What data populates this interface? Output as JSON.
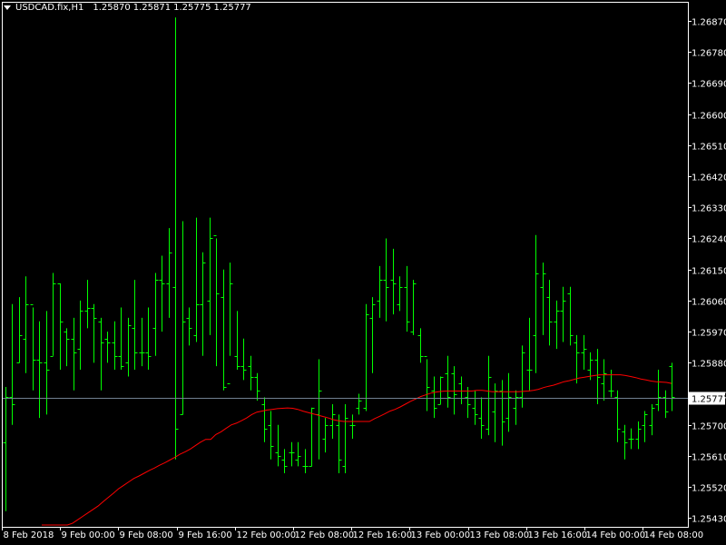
{
  "header": {
    "symbol": "USDCAD.fix,H1",
    "open": "1.25870",
    "high": "1.25871",
    "low": "1.25775",
    "close": "1.25777"
  },
  "current_price_label": "1.25777",
  "colors": {
    "background": "#000000",
    "bars": "#00ff00",
    "moving_average": "#ff0000",
    "bid_line": "#708090",
    "axis": "#ffffff",
    "text": "#ffffff"
  },
  "chart_data": {
    "type": "line",
    "chart_style": "ohlc-bars",
    "y_ticks": [
      "1.26870",
      "1.26780",
      "1.26690",
      "1.26600",
      "1.26510",
      "1.26420",
      "1.26330",
      "1.26240",
      "1.26150",
      "1.26060",
      "1.25970",
      "1.25880",
      "1.25790",
      "1.25700",
      "1.25610",
      "1.25520",
      "1.25430"
    ],
    "x_ticks": [
      "8 Feb 2018",
      "9 Feb 00:00",
      "9 Feb 08:00",
      "9 Feb 16:00",
      "12 Feb 00:00",
      "12 Feb 08:00",
      "12 Feb 16:00",
      "13 Feb 00:00",
      "13 Feb 08:00",
      "13 Feb 16:00",
      "14 Feb 00:00",
      "14 Feb 08:00"
    ],
    "ylim": [
      1.2541,
      1.2692
    ],
    "current_price": 1.25777,
    "series": [
      {
        "type": "ohlc",
        "bars": [
          {
            "h": 1.2581,
            "l": 1.2545,
            "o": 1.2565,
            "c": 1.2578
          },
          {
            "h": 1.2605,
            "l": 1.257,
            "o": 1.2578,
            "c": 1.2576
          },
          {
            "h": 1.2607,
            "l": 1.2588,
            "o": 1.2588,
            "c": 1.2596
          },
          {
            "h": 1.2613,
            "l": 1.2585,
            "o": 1.2595,
            "c": 1.2605
          },
          {
            "h": 1.2604,
            "l": 1.258,
            "o": 1.2605,
            "c": 1.2589
          },
          {
            "h": 1.26,
            "l": 1.2572,
            "o": 1.2589,
            "c": 1.2588
          },
          {
            "h": 1.2603,
            "l": 1.2573,
            "o": 1.2588,
            "c": 1.2586
          },
          {
            "h": 1.2614,
            "l": 1.259,
            "o": 1.259,
            "c": 1.2611
          },
          {
            "h": 1.2611,
            "l": 1.2586,
            "o": 1.2611,
            "c": 1.26
          },
          {
            "h": 1.2598,
            "l": 1.2587,
            "o": 1.2597,
            "c": 1.2595
          },
          {
            "h": 1.2601,
            "l": 1.258,
            "o": 1.2595,
            "c": 1.2591
          },
          {
            "h": 1.2606,
            "l": 1.2586,
            "o": 1.2592,
            "c": 1.2603
          },
          {
            "h": 1.2612,
            "l": 1.2598,
            "o": 1.2603,
            "c": 1.2604
          },
          {
            "h": 1.2605,
            "l": 1.2588,
            "o": 1.2604,
            "c": 1.2601
          },
          {
            "h": 1.2601,
            "l": 1.258,
            "o": 1.26,
            "c": 1.2594
          },
          {
            "h": 1.2597,
            "l": 1.2588,
            "o": 1.2595,
            "c": 1.2594
          },
          {
            "h": 1.26,
            "l": 1.2586,
            "o": 1.2594,
            "c": 1.259
          },
          {
            "h": 1.2604,
            "l": 1.2586,
            "o": 1.259,
            "c": 1.2587
          },
          {
            "h": 1.2601,
            "l": 1.2584,
            "o": 1.2588,
            "c": 1.2599
          },
          {
            "h": 1.2612,
            "l": 1.2586,
            "o": 1.2598,
            "c": 1.2591
          },
          {
            "h": 1.2601,
            "l": 1.2587,
            "o": 1.2591,
            "c": 1.2591
          },
          {
            "h": 1.2604,
            "l": 1.2586,
            "o": 1.2591,
            "c": 1.259
          },
          {
            "h": 1.2614,
            "l": 1.259,
            "o": 1.2598,
            "c": 1.2612
          },
          {
            "h": 1.2619,
            "l": 1.2597,
            "o": 1.2612,
            "c": 1.2611
          },
          {
            "h": 1.2627,
            "l": 1.2601,
            "o": 1.2611,
            "c": 1.262
          },
          {
            "h": 1.2688,
            "l": 1.256,
            "o": 1.261,
            "c": 1.2569
          },
          {
            "h": 1.2629,
            "l": 1.2573,
            "o": 1.2573,
            "c": 1.26
          },
          {
            "h": 1.2604,
            "l": 1.2593,
            "o": 1.2601,
            "c": 1.2598
          },
          {
            "h": 1.263,
            "l": 1.2594,
            "o": 1.2596,
            "c": 1.2605
          },
          {
            "h": 1.262,
            "l": 1.259,
            "o": 1.2605,
            "c": 1.2617
          },
          {
            "h": 1.263,
            "l": 1.2596,
            "o": 1.2606,
            "c": 1.2624
          },
          {
            "h": 1.2624,
            "l": 1.2587,
            "o": 1.2625,
            "c": 1.2608
          },
          {
            "h": 1.2615,
            "l": 1.258,
            "o": 1.2607,
            "c": 1.2581
          },
          {
            "h": 1.2617,
            "l": 1.259,
            "o": 1.2582,
            "c": 1.2611
          },
          {
            "h": 1.2603,
            "l": 1.2586,
            "o": 1.259,
            "c": 1.2587
          },
          {
            "h": 1.2595,
            "l": 1.2583,
            "o": 1.2587,
            "c": 1.2586
          },
          {
            "h": 1.259,
            "l": 1.258,
            "o": 1.2587,
            "c": 1.2584
          },
          {
            "h": 1.2585,
            "l": 1.2577,
            "o": 1.2584,
            "c": 1.258
          },
          {
            "h": 1.2578,
            "l": 1.2565,
            "o": 1.2576,
            "c": 1.2569
          },
          {
            "h": 1.2574,
            "l": 1.256,
            "o": 1.257,
            "c": 1.2564
          },
          {
            "h": 1.257,
            "l": 1.2558,
            "o": 1.2562,
            "c": 1.2561
          },
          {
            "h": 1.2563,
            "l": 1.2556,
            "o": 1.256,
            "c": 1.2558
          },
          {
            "h": 1.2565,
            "l": 1.2558,
            "o": 1.2562,
            "c": 1.2562
          },
          {
            "h": 1.2565,
            "l": 1.2558,
            "o": 1.256,
            "c": 1.2561
          },
          {
            "h": 1.2563,
            "l": 1.2556,
            "o": 1.2558,
            "c": 1.2558
          },
          {
            "h": 1.2575,
            "l": 1.2558,
            "o": 1.2558,
            "c": 1.2575
          },
          {
            "h": 1.2589,
            "l": 1.256,
            "o": 1.2573,
            "c": 1.258
          },
          {
            "h": 1.2572,
            "l": 1.2562,
            "o": 1.2566,
            "c": 1.257
          },
          {
            "h": 1.2576,
            "l": 1.2566,
            "o": 1.257,
            "c": 1.2573
          },
          {
            "h": 1.2573,
            "l": 1.2556,
            "o": 1.257,
            "c": 1.256
          },
          {
            "h": 1.2576,
            "l": 1.2556,
            "o": 1.2558,
            "c": 1.2572
          },
          {
            "h": 1.2573,
            "l": 1.2566,
            "o": 1.257,
            "c": 1.257
          },
          {
            "h": 1.2579,
            "l": 1.2573,
            "o": 1.2575,
            "c": 1.2577
          },
          {
            "h": 1.2605,
            "l": 1.2574,
            "o": 1.2575,
            "c": 1.2602
          },
          {
            "h": 1.2607,
            "l": 1.2585,
            "o": 1.2601,
            "c": 1.2605
          },
          {
            "h": 1.2616,
            "l": 1.2601,
            "o": 1.2606,
            "c": 1.2612
          },
          {
            "h": 1.2624,
            "l": 1.26,
            "o": 1.2612,
            "c": 1.261
          },
          {
            "h": 1.2621,
            "l": 1.2602,
            "o": 1.2612,
            "c": 1.2611
          },
          {
            "h": 1.2613,
            "l": 1.2603,
            "o": 1.2605,
            "c": 1.261
          },
          {
            "h": 1.2616,
            "l": 1.2597,
            "o": 1.261,
            "c": 1.26
          },
          {
            "h": 1.2612,
            "l": 1.2596,
            "o": 1.2597,
            "c": 1.2611
          },
          {
            "h": 1.2598,
            "l": 1.2588,
            "o": 1.2596,
            "c": 1.259
          },
          {
            "h": 1.2589,
            "l": 1.2574,
            "o": 1.259,
            "c": 1.2581
          },
          {
            "h": 1.2584,
            "l": 1.2572,
            "o": 1.258,
            "c": 1.2575
          },
          {
            "h": 1.2584,
            "l": 1.2576,
            "o": 1.2576,
            "c": 1.2584
          },
          {
            "h": 1.259,
            "l": 1.2575,
            "o": 1.2585,
            "c": 1.2578
          },
          {
            "h": 1.2587,
            "l": 1.2573,
            "o": 1.2585,
            "c": 1.2579
          },
          {
            "h": 1.2584,
            "l": 1.2576,
            "o": 1.2582,
            "c": 1.258
          },
          {
            "h": 1.2581,
            "l": 1.2572,
            "o": 1.2578,
            "c": 1.2576
          },
          {
            "h": 1.258,
            "l": 1.257,
            "o": 1.2575,
            "c": 1.2573
          },
          {
            "h": 1.2578,
            "l": 1.2566,
            "o": 1.2572,
            "c": 1.257
          },
          {
            "h": 1.259,
            "l": 1.2567,
            "o": 1.2569,
            "c": 1.2584
          },
          {
            "h": 1.2582,
            "l": 1.2565,
            "o": 1.2574,
            "c": 1.258
          },
          {
            "h": 1.2583,
            "l": 1.2564,
            "o": 1.258,
            "c": 1.2571
          },
          {
            "h": 1.2585,
            "l": 1.2568,
            "o": 1.2572,
            "c": 1.2578
          },
          {
            "h": 1.258,
            "l": 1.257,
            "o": 1.2575,
            "c": 1.2578
          },
          {
            "h": 1.2593,
            "l": 1.2575,
            "o": 1.2578,
            "c": 1.2591
          },
          {
            "h": 1.2601,
            "l": 1.258,
            "o": 1.2586,
            "c": 1.2586
          },
          {
            "h": 1.2625,
            "l": 1.2585,
            "o": 1.2596,
            "c": 1.2614
          },
          {
            "h": 1.2617,
            "l": 1.2596,
            "o": 1.261,
            "c": 1.2614
          },
          {
            "h": 1.2612,
            "l": 1.2593,
            "o": 1.2607,
            "c": 1.26
          },
          {
            "h": 1.2606,
            "l": 1.2592,
            "o": 1.26,
            "c": 1.2603
          },
          {
            "h": 1.261,
            "l": 1.2594,
            "o": 1.2603,
            "c": 1.2606
          },
          {
            "h": 1.261,
            "l": 1.2593,
            "o": 1.2608,
            "c": 1.2596
          },
          {
            "h": 1.2596,
            "l": 1.2582,
            "o": 1.2594,
            "c": 1.2591
          },
          {
            "h": 1.2596,
            "l": 1.2586,
            "o": 1.2591,
            "c": 1.2592
          },
          {
            "h": 1.2591,
            "l": 1.2583,
            "o": 1.2586,
            "c": 1.2589
          },
          {
            "h": 1.2592,
            "l": 1.2576,
            "o": 1.2589,
            "c": 1.2584
          },
          {
            "h": 1.2589,
            "l": 1.2577,
            "o": 1.2582,
            "c": 1.2585
          },
          {
            "h": 1.2586,
            "l": 1.2578,
            "o": 1.258,
            "c": 1.258
          },
          {
            "h": 1.258,
            "l": 1.2565,
            "o": 1.2578,
            "c": 1.2569
          },
          {
            "h": 1.257,
            "l": 1.256,
            "o": 1.2568,
            "c": 1.2565
          },
          {
            "h": 1.2569,
            "l": 1.2563,
            "o": 1.2566,
            "c": 1.2566
          },
          {
            "h": 1.2571,
            "l": 1.2563,
            "o": 1.2566,
            "c": 1.2569
          },
          {
            "h": 1.2574,
            "l": 1.2565,
            "o": 1.257,
            "c": 1.2573
          },
          {
            "h": 1.2576,
            "l": 1.2567,
            "o": 1.257,
            "c": 1.2575
          },
          {
            "h": 1.2586,
            "l": 1.2574,
            "o": 1.2576,
            "c": 1.2578
          },
          {
            "h": 1.258,
            "l": 1.2572,
            "o": 1.2578,
            "c": 1.2574
          },
          {
            "h": 1.2588,
            "l": 1.2574,
            "o": 1.2587,
            "c": 1.2578
          }
        ]
      },
      {
        "type": "line",
        "values": [
          1.2541,
          1.2541,
          1.2541,
          1.2541,
          1.2541,
          1.2541,
          1.25415,
          1.25425,
          1.25435,
          1.25445,
          1.25455,
          1.25465,
          1.25478,
          1.2549,
          1.25502,
          1.25515,
          1.25525,
          1.25535,
          1.25545,
          1.25552,
          1.2556,
          1.25568,
          1.25575,
          1.25583,
          1.2559,
          1.25598,
          1.25606,
          1.25615,
          1.25622,
          1.2563,
          1.2564,
          1.2565,
          1.25658,
          1.25658,
          1.25672,
          1.2568,
          1.2569,
          1.257,
          1.25705,
          1.25712,
          1.2572,
          1.2573,
          1.25737,
          1.2574,
          1.25743,
          1.25745,
          1.25747,
          1.25748,
          1.25749,
          1.25748,
          1.25745,
          1.2574,
          1.25736,
          1.25732,
          1.25728,
          1.25724,
          1.2572,
          1.25715,
          1.25712,
          1.2571,
          1.2571,
          1.2571,
          1.2571,
          1.2571,
          1.2571,
          1.25718,
          1.25725,
          1.25732,
          1.2574,
          1.25745,
          1.25752,
          1.2576,
          1.25768,
          1.25775,
          1.25782,
          1.25787,
          1.25792,
          1.25795,
          1.25797,
          1.25798,
          1.25798,
          1.25798,
          1.25798,
          1.25798,
          1.25798,
          1.258,
          1.258,
          1.25798,
          1.25796,
          1.25796,
          1.25796,
          1.25796,
          1.25796,
          1.25796,
          1.25797,
          1.25798,
          1.258,
          1.25803,
          1.25808,
          1.25812,
          1.25815,
          1.2582,
          1.25825,
          1.25828,
          1.25832,
          1.25836,
          1.25838,
          1.25841,
          1.25843,
          1.25845,
          1.25845,
          1.25845,
          1.25845,
          1.25845,
          1.25843,
          1.2584,
          1.25837,
          1.25833,
          1.2583,
          1.25827,
          1.25825,
          1.25824,
          1.25823,
          1.2582
        ]
      }
    ]
  }
}
